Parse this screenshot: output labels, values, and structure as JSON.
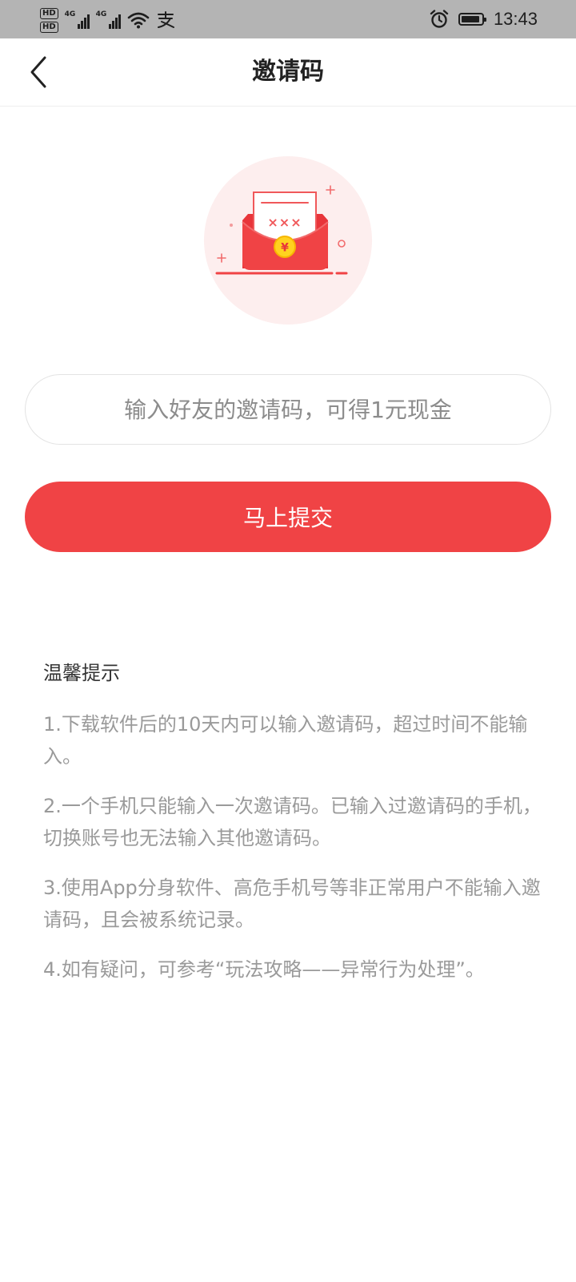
{
  "status_bar": {
    "hd_labels": [
      "HD",
      "HD"
    ],
    "network_labels": [
      "4G",
      "4G"
    ],
    "time": "13:43",
    "icons": [
      "wifi-icon",
      "alipay-icon",
      "alarm-icon",
      "battery-icon"
    ]
  },
  "nav": {
    "title": "邀请码",
    "back_icon": "chevron-left-icon"
  },
  "hero": {
    "icon": "red-envelope-icon",
    "letter_text": "×××",
    "coin_symbol": "¥",
    "colors": {
      "envelope": "#f04345",
      "circle_bg": "#fdeeee",
      "coin": "#ffd21f"
    }
  },
  "invite_form": {
    "placeholder": "输入好友的邀请码，可得1元现金",
    "value": "",
    "submit_label": "马上提交"
  },
  "tips": {
    "title": "温馨提示",
    "items": [
      "1.下载软件后的10天内可以输入邀请码，超过时间不能输入。",
      "2.一个手机只能输入一次邀请码。已输入过邀请码的手机，切换账号也无法输入其他邀请码。",
      "3.使用App分身软件、高危手机号等非正常用户不能输入邀请码，且会被系统记录。",
      "4.如有疑问，可参考“玩法攻略——异常行为处理”。"
    ]
  },
  "colors": {
    "accent": "#f04345",
    "tip_text": "#9a9a9a",
    "title_text": "#222222"
  }
}
